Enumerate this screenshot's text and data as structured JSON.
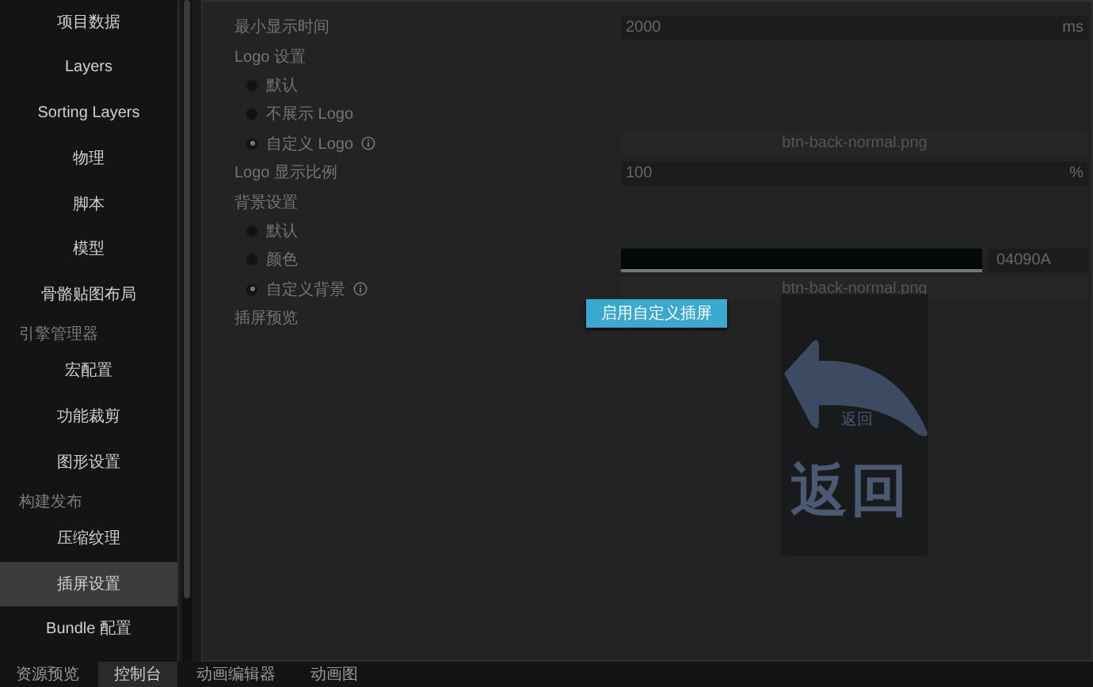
{
  "sidebar": {
    "items": [
      {
        "kind": "item",
        "label": "项目数据",
        "selected": false
      },
      {
        "kind": "item",
        "label": "Layers",
        "selected": false
      },
      {
        "kind": "item",
        "label": "Sorting Layers",
        "selected": false
      },
      {
        "kind": "item",
        "label": "物理",
        "selected": false
      },
      {
        "kind": "item",
        "label": "脚本",
        "selected": false
      },
      {
        "kind": "item",
        "label": "模型",
        "selected": false
      },
      {
        "kind": "item",
        "label": "骨骼贴图布局",
        "selected": false
      },
      {
        "kind": "group",
        "label": "引擎管理器"
      },
      {
        "kind": "item",
        "label": "宏配置",
        "selected": false
      },
      {
        "kind": "item",
        "label": "功能裁剪",
        "selected": false
      },
      {
        "kind": "item",
        "label": "图形设置",
        "selected": false
      },
      {
        "kind": "group",
        "label": "构建发布"
      },
      {
        "kind": "item",
        "label": "压缩纹理",
        "selected": false
      },
      {
        "kind": "item",
        "label": "插屏设置",
        "selected": true
      },
      {
        "kind": "item",
        "label": "Bundle 配置",
        "selected": false
      }
    ]
  },
  "settings": [
    {
      "kind": "number",
      "label": "最小显示时间",
      "value": "2000",
      "unit": "ms"
    },
    {
      "kind": "heading",
      "label": "Logo 设置"
    },
    {
      "kind": "radio",
      "label": "默认",
      "selected": false
    },
    {
      "kind": "radio",
      "label": "不展示 Logo",
      "selected": false
    },
    {
      "kind": "radio",
      "label": "自定义 Logo",
      "selected": true,
      "info": true,
      "file": "btn-back-normal.png"
    },
    {
      "kind": "number",
      "label": "Logo 显示比例",
      "value": "100",
      "unit": "%"
    },
    {
      "kind": "heading",
      "label": "背景设置"
    },
    {
      "kind": "radio",
      "label": "默认",
      "selected": false
    },
    {
      "kind": "radio",
      "label": "颜色",
      "selected": false,
      "hex": "04090A"
    },
    {
      "kind": "radio",
      "label": "自定义背景",
      "selected": true,
      "info": true,
      "file": "btn-back-normal.png"
    },
    {
      "kind": "preview",
      "label": "插屏预览",
      "button": "启用自定义插屏",
      "small_text": "返回",
      "big_text": "返回"
    }
  ],
  "bottom_tabs": [
    {
      "label": "资源预览",
      "selected": false
    },
    {
      "label": "控制台",
      "selected": true
    },
    {
      "label": "动画编辑器",
      "selected": false
    },
    {
      "label": "动画图",
      "selected": false
    }
  ]
}
